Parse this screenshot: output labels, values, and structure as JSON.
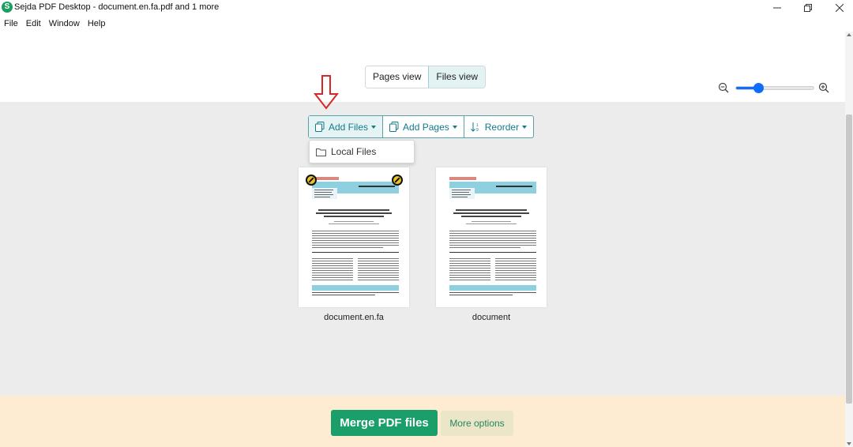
{
  "window": {
    "title": "Sejda PDF Desktop - document.en.fa.pdf and 1 more",
    "logo_letter": "S"
  },
  "menu": [
    "File",
    "Edit",
    "Window",
    "Help"
  ],
  "views": {
    "pages": "Pages view",
    "files": "Files view",
    "active": "files"
  },
  "zoom": {
    "level": 0.25
  },
  "toolbar": {
    "add_files": "Add Files",
    "add_pages": "Add Pages",
    "reorder": "Reorder"
  },
  "dropdown": {
    "local_files": "Local Files"
  },
  "files": [
    {
      "name": "document.en.fa"
    },
    {
      "name": "document"
    }
  ],
  "footer": {
    "merge": "Merge PDF files",
    "more": "More options"
  },
  "colors": {
    "accent": "#117a8b",
    "merge": "#1a9e6a",
    "footer_bg": "#fdebd2",
    "arrow": "#d62828"
  }
}
